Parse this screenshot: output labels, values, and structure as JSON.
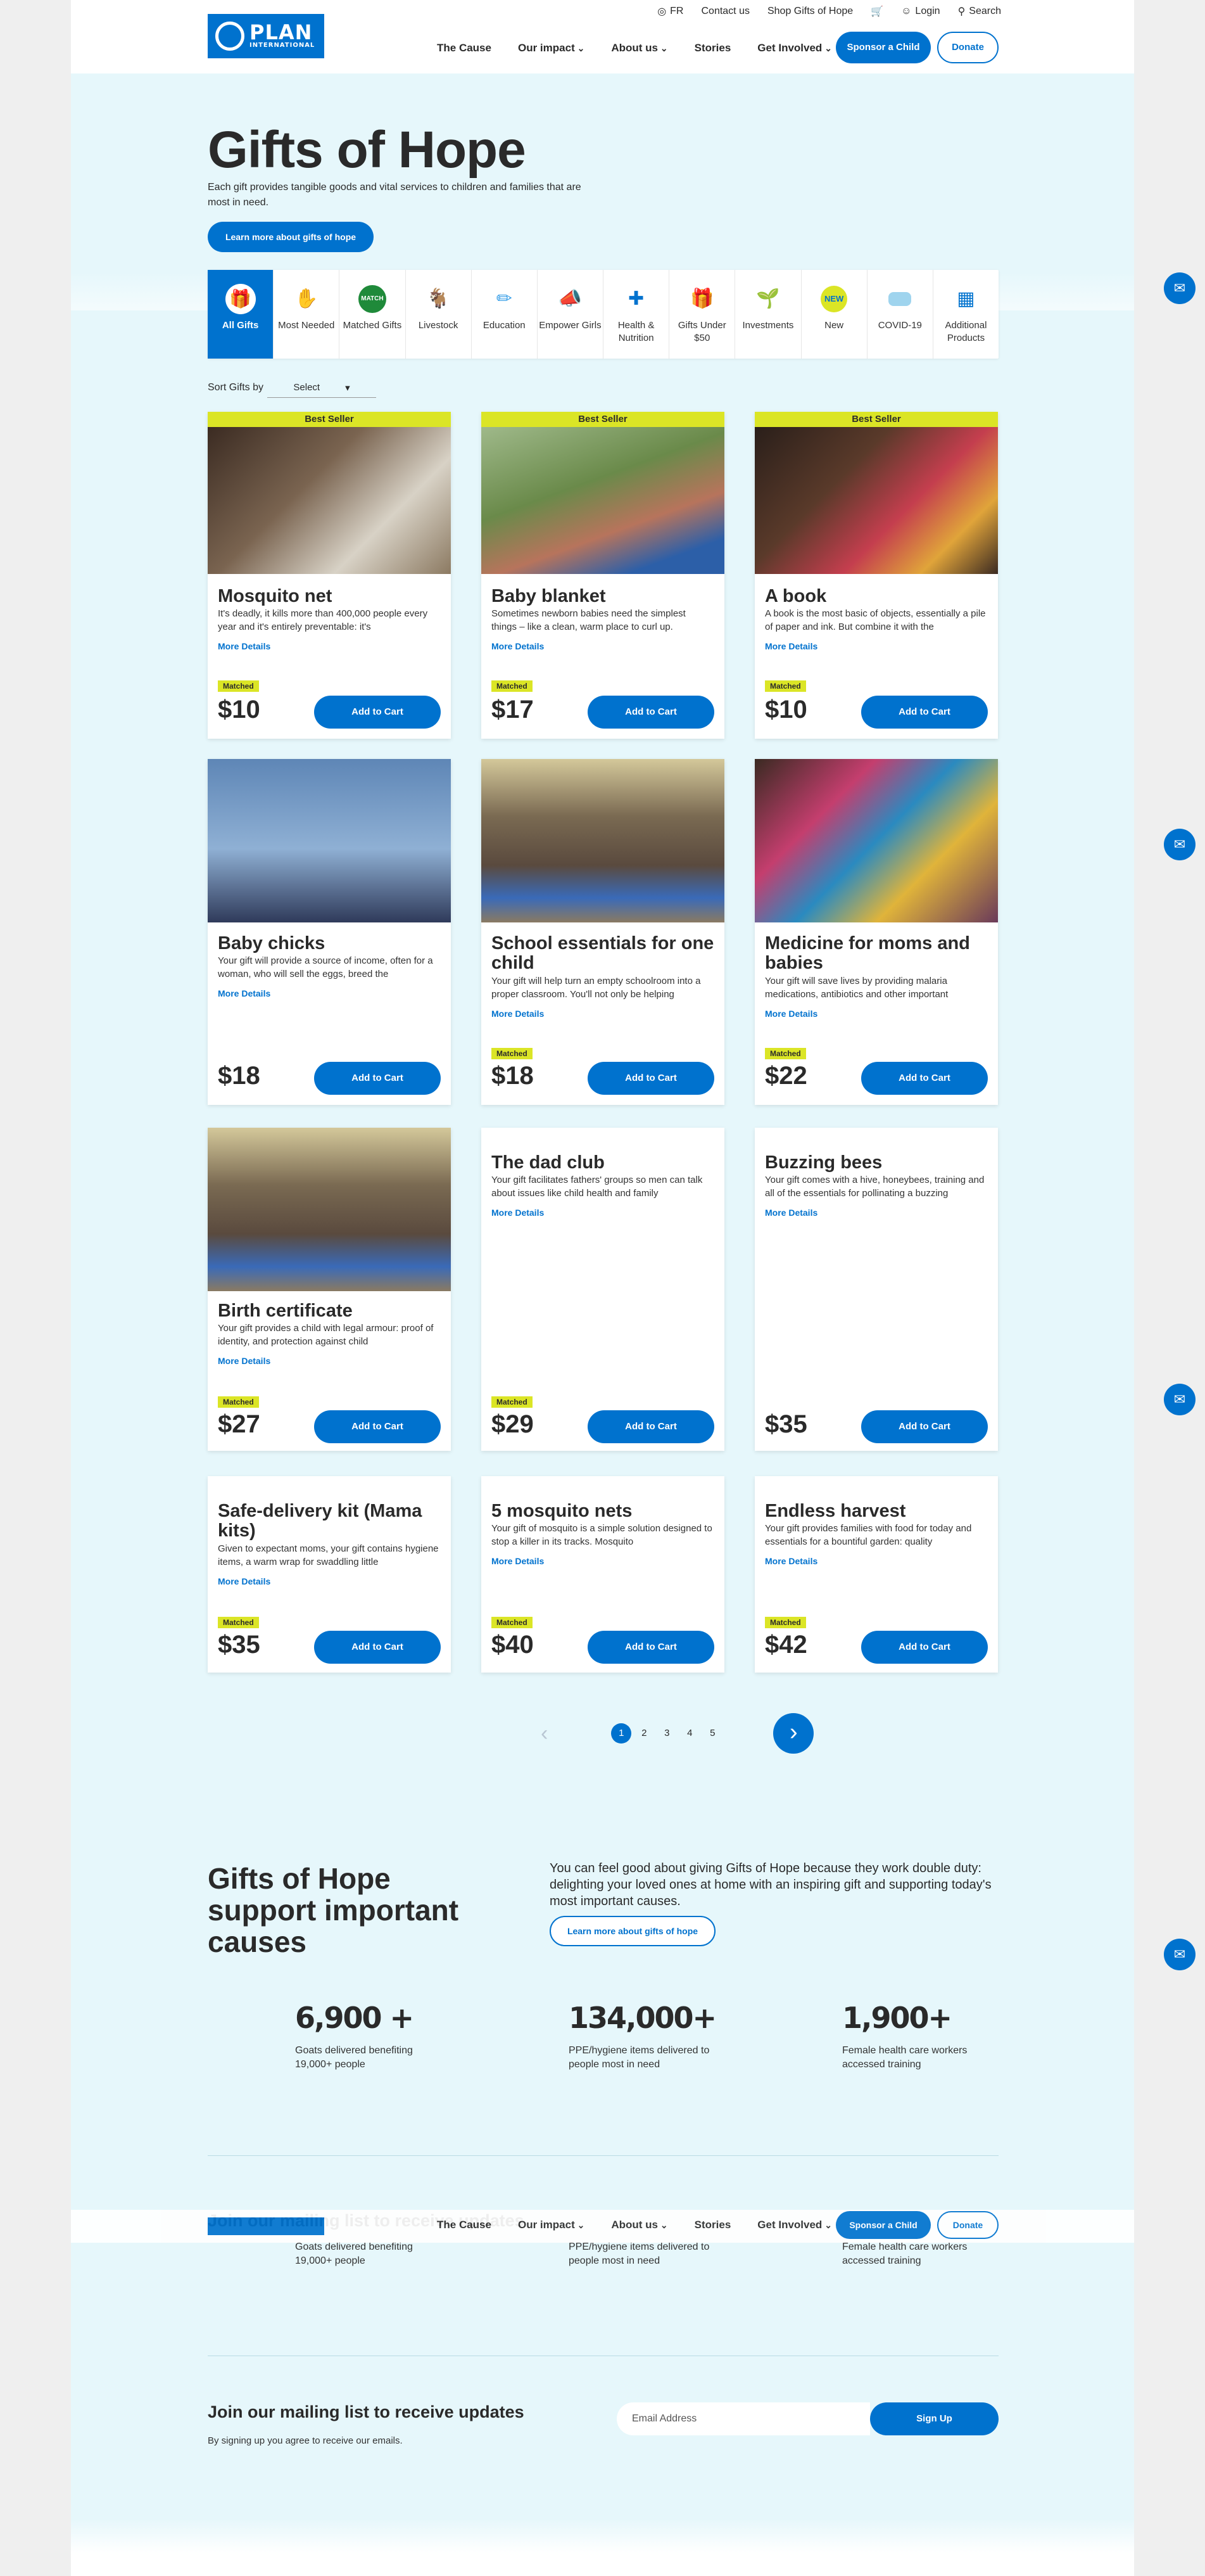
{
  "header": {
    "logo_word": "PLAN",
    "logo_sub": "INTERNATIONAL",
    "utility": [
      "FR",
      "Contact us",
      "Shop Gifts of Hope",
      "Login",
      "Search"
    ],
    "nav": [
      "The Cause",
      "Our impact",
      "About us",
      "Stories",
      "Get Involved"
    ],
    "sponsor_label": "Sponsor a Child",
    "donate_label": "Donate"
  },
  "hero": {
    "title": "Gifts of Hope",
    "description": "Each gift provides tangible goods and vital services to children and families that are most in need.",
    "cta": "Learn more about gifts of hope"
  },
  "categories": [
    {
      "label": "All Gifts",
      "icon": "gift-icon"
    },
    {
      "label": "Most Needed",
      "icon": "hand-icon"
    },
    {
      "label": "Matched Gifts",
      "icon": "matched-icon"
    },
    {
      "label": "Livestock",
      "icon": "goat-icon"
    },
    {
      "label": "Education",
      "icon": "pencil-icon"
    },
    {
      "label": "Empower Girls",
      "icon": "megaphone-icon"
    },
    {
      "label": "Health & Nutrition",
      "icon": "medkit-icon"
    },
    {
      "label": "Gifts Under $50",
      "icon": "gifts-icon"
    },
    {
      "label": "Investments",
      "icon": "plant-icon"
    },
    {
      "label": "New",
      "icon": "new-icon"
    },
    {
      "label": "COVID-19",
      "icon": "mask-icon"
    },
    {
      "label": "Additional Products",
      "icon": "products-icon"
    }
  ],
  "sort": {
    "label": "Sort Gifts by",
    "value": "Select"
  },
  "badges": {
    "best_seller": "Best Seller",
    "matched": "Matched"
  },
  "card_labels": {
    "more": "More Details",
    "add": "Add to Cart"
  },
  "products": [
    {
      "title": "Mosquito net",
      "desc": "It's deadly, it kills more than 400,000 people every year and it's entirely preventable: it's",
      "price": "$10"
    },
    {
      "title": "Baby blanket",
      "desc": "Sometimes newborn babies need the simplest things – like a clean, warm place to curl up.",
      "price": "$17"
    },
    {
      "title": "A book",
      "desc": "A book is the most basic of objects, essentially a pile of paper and ink. But combine it with the",
      "price": "$10"
    },
    {
      "title": "Baby chicks",
      "desc": "Your gift will provide a source of income, often for a woman, who will sell the eggs, breed the",
      "price": "$18"
    },
    {
      "title": "School essentials for one child",
      "desc": "Your gift will help turn an empty schoolroom into a proper classroom. You'll not only be helping",
      "price": "$18"
    },
    {
      "title": "Medicine for moms and babies",
      "desc": "Your gift will save lives by providing malaria medications, antibiotics and other important",
      "price": "$22"
    },
    {
      "title": "Birth certificate",
      "desc": "Your gift provides a child with legal armour: proof of identity, and protection against child",
      "price": "$27"
    },
    {
      "title": "The dad club",
      "desc": "Your gift facilitates fathers' groups so men can talk about issues like child health and family",
      "price": "$29"
    },
    {
      "title": "Buzzing bees",
      "desc": "Your gift comes with a hive, honeybees, training and all of the essentials for pollinating a buzzing",
      "price": "$35"
    },
    {
      "title": "Safe-delivery kit (Mama kits)",
      "desc": "Given to expectant moms, your gift contains hygiene items, a warm wrap for swaddling little",
      "price": "$35"
    },
    {
      "title": "5 mosquito nets",
      "desc": "Your gift of mosquito is a simple solution designed to stop a killer in its tracks. Mosquito",
      "price": "$40"
    },
    {
      "title": "Endless harvest",
      "desc": "Your gift provides families with food for today and essentials for a bountiful garden: quality",
      "price": "$42"
    }
  ],
  "pagination": {
    "pages": [
      "1",
      "2",
      "3",
      "4",
      "5"
    ],
    "current": "1"
  },
  "support": {
    "title": "Gifts of Hope support important causes",
    "description": "You can feel good about giving Gifts of Hope because they work double duty: delighting your loved ones at home with an inspiring gift and supporting today's most important causes.",
    "cta": "Learn more about gifts of hope",
    "stats": [
      {
        "number": "6,900 +",
        "label": "Goats delivered benefiting 19,000+ people"
      },
      {
        "number": "134,000+",
        "label": "PPE/hygiene items delivered to people most in need"
      },
      {
        "number": "1,900+",
        "label": "Female health care workers accessed training"
      }
    ]
  },
  "mailing": {
    "title": "Join our mailing list to receive updates",
    "note": "By signing up you agree to receive our emails.",
    "placeholder": "Email Address",
    "button": "Sign Up"
  },
  "colors": {
    "brand": "#0072ce",
    "accent": "#dbe526",
    "background": "#e6f7fb"
  }
}
